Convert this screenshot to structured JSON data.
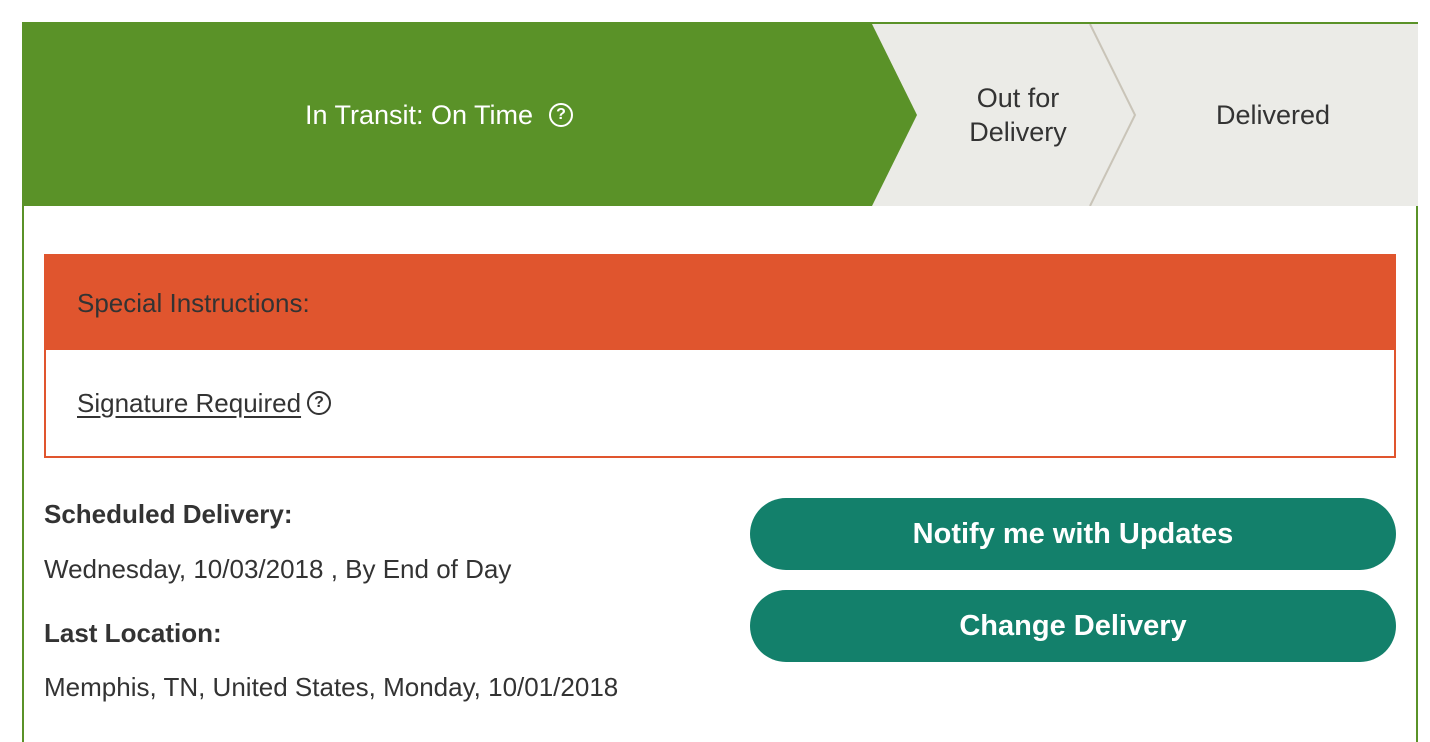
{
  "progress": {
    "steps": [
      {
        "label": "In Transit: On Time",
        "state": "active"
      },
      {
        "label_line1": "Out for",
        "label_line2": "Delivery",
        "state": "pending"
      },
      {
        "label": "Delivered",
        "state": "pending"
      }
    ],
    "help_glyph": "?"
  },
  "instructions": {
    "header": "Special Instructions:",
    "signature_label": "Signature Required",
    "help_glyph": "?"
  },
  "details": {
    "scheduled_label": "Scheduled Delivery:",
    "scheduled_value": "Wednesday, 10/03/2018 , By End of Day",
    "location_label": "Last Location:",
    "location_value": "Memphis, TN, United States, Monday, 10/01/2018"
  },
  "actions": {
    "notify_label": "Notify me with Updates",
    "change_label": "Change Delivery"
  },
  "colors": {
    "active_step": "#5a9228",
    "pending_step": "#ebebe7",
    "instructions_accent": "#e0552e",
    "button": "#13806b"
  },
  "icons": {
    "help": "question-circle-icon"
  }
}
